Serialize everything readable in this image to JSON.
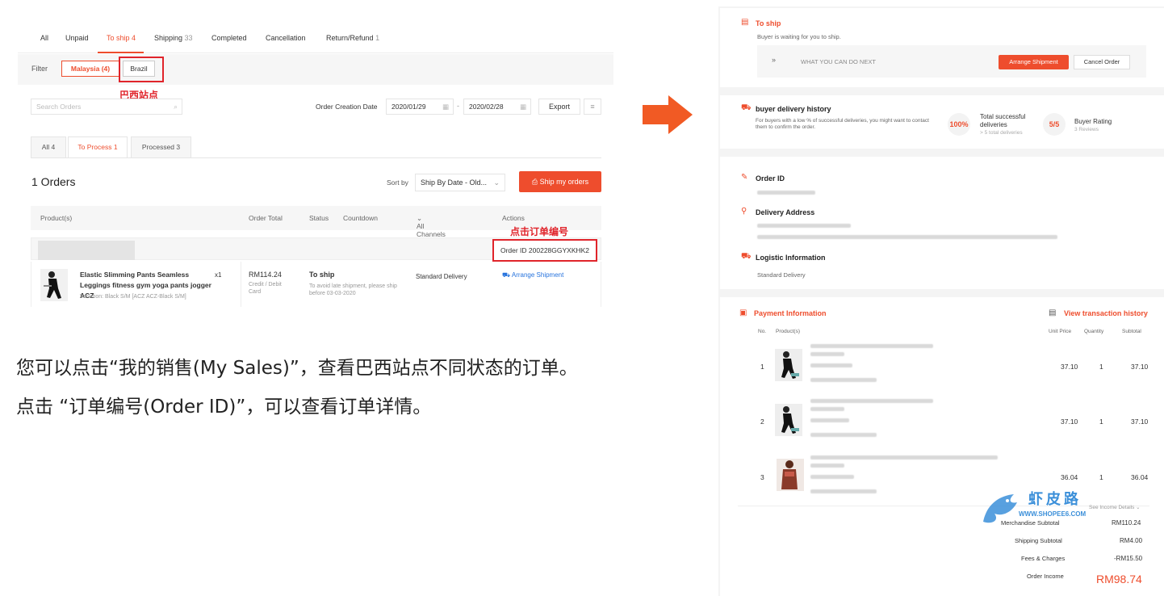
{
  "left_panel": {
    "tabs": [
      {
        "label": "All",
        "count": ""
      },
      {
        "label": "Unpaid",
        "count": ""
      },
      {
        "label": "To ship 4",
        "count": ""
      },
      {
        "label": "Shipping",
        "count": "33"
      },
      {
        "label": "Completed",
        "count": ""
      },
      {
        "label": "Cancellation",
        "count": ""
      },
      {
        "label": "Return/Refund",
        "count": "1"
      }
    ],
    "filter_label": "Filter",
    "region_chips": [
      "Malaysia (4)",
      "Brazil"
    ],
    "brazil_note": "巴西站点",
    "search_placeholder": "Search Orders",
    "date_label": "Order Creation Date",
    "date_from": "2020/01/29",
    "date_sep": "-",
    "date_to": "2020/02/28",
    "export_label": "Export",
    "sub_tabs": [
      "All 4",
      "To Process 1",
      "Processed 3"
    ],
    "orders_count": "1 Orders",
    "sort_label": "Sort by",
    "sort_value": "Ship By Date - Old...",
    "ship_button": "Ship my orders",
    "table_headers": {
      "product": "Product(s)",
      "total": "Order Total",
      "status": "Status",
      "countdown": "Countdown",
      "channels": "All Channels",
      "actions": "Actions"
    },
    "order_id_note": "点击订单编号",
    "order_id": "Order ID 200228GGYXKHK2",
    "product_name": "Elastic Slimming Pants Seamless Leggings fitness gym yoga pants jogger ACZ",
    "quantity": "x1",
    "variation": "Variation: Black S/M [ACZ ACZ-Black S/M]",
    "order_total": "RM114.24",
    "payment": "Credit / Debit Card",
    "status": "To ship",
    "status_note": "To avoid late shipment, please ship before 03-03-2020",
    "channel": "Standard Delivery",
    "action": "Arrange Shipment"
  },
  "instructions": [
    "您可以点击“我的销售(My Sales)”，查看巴西站点不同状态的订单。",
    "点击 “订单编号(Order ID)”，可以查看订单详情。"
  ],
  "right_panel": {
    "to_ship_title": "To ship",
    "to_ship_sub": "Buyer is waiting for you to ship.",
    "what_next": "WHAT YOU CAN DO NEXT",
    "arrange_btn": "Arrange Shipment",
    "cancel_btn": "Cancel Order",
    "history_title": "buyer delivery history",
    "history_note": "For buyers with a low % of successful deliveries, you might want to contact them to confirm the order.",
    "success_rate": "100%",
    "success_label": "Total successful deliveries",
    "success_sub": "> 5 total deliveries",
    "rating": "5/5",
    "rating_label": "Buyer Rating",
    "rating_sub": "3 Reviews",
    "order_id_title": "Order ID",
    "address_title": "Delivery Address",
    "logistic_title": "Logistic Information",
    "logistic_value": "Standard Delivery",
    "payment_title": "Payment Information",
    "transaction_link": "View transaction history",
    "pay_headers": {
      "no": "No.",
      "product": "Product(s)",
      "unit": "Unit Price",
      "qty": "Quantity",
      "subtotal": "Subtotal"
    },
    "pay_rows": [
      {
        "no": "1",
        "unit": "37.10",
        "qty": "1",
        "subtotal": "37.10"
      },
      {
        "no": "2",
        "unit": "37.10",
        "qty": "1",
        "subtotal": "37.10"
      },
      {
        "no": "3",
        "unit": "36.04",
        "qty": "1",
        "subtotal": "36.04"
      }
    ],
    "income_details": "See Income Details",
    "summary": [
      {
        "label": "Merchandise Subtotal",
        "value": "RM110.24"
      },
      {
        "label": "Shipping Subtotal",
        "value": "RM4.00"
      },
      {
        "label": "Fees & Charges",
        "value": "-RM15.50"
      }
    ],
    "order_income_label": "Order Income",
    "order_income_value": "RM98.74",
    "watermark_cn": "虾皮路",
    "watermark_url": "WWW.SHOPEE6.COM"
  },
  "colors": {
    "accent": "#ee4d2d",
    "annotation": "#e0242b",
    "arrow": "#f15a24"
  }
}
